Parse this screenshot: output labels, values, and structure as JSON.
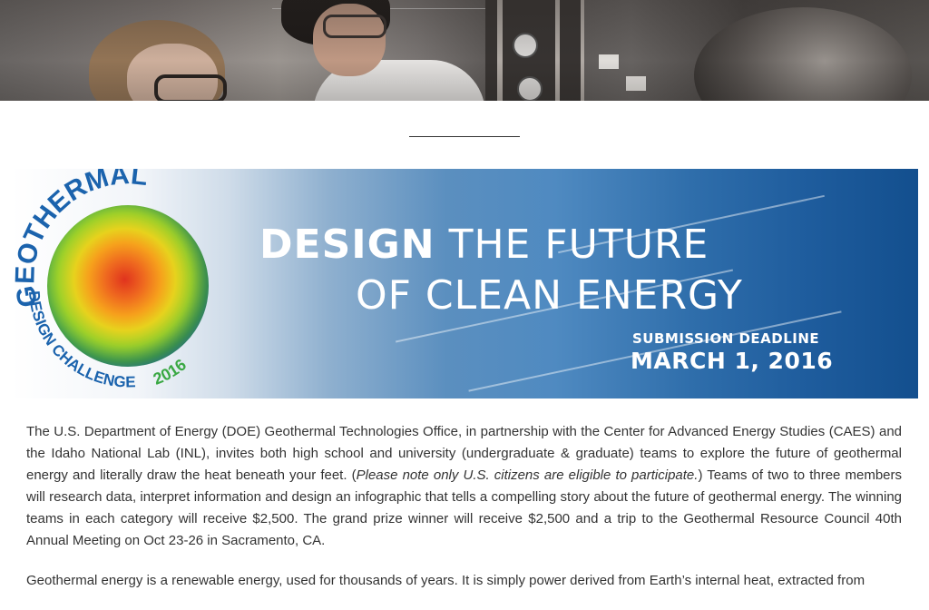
{
  "hero": {
    "image_description": "Two researchers wearing safety glasses working at lab equipment with gauges and pipes"
  },
  "banner": {
    "logo": {
      "arc_top": "GEOTHERMAL",
      "arc_bottom": "DESIGN CHALLENGE",
      "year": "2016"
    },
    "headline_bold": "DESIGN",
    "headline_rest": "THE FUTURE",
    "headline_line2": "OF CLEAN ENERGY",
    "deadline_label": "SUBMISSION DEADLINE",
    "deadline_date": "MARCH 1, 2016"
  },
  "content": {
    "p1_part1": "The U.S. Department of Energy (DOE) Geothermal Technologies Office, in partnership with the Center for Advanced Energy Studies (CAES) and the Idaho National Lab (INL), invites both high school and university (undergraduate & graduate) teams to explore the future of geothermal energy and literally draw the heat beneath your feet. (",
    "p1_italic": "Please note only U.S. citizens are eligible to participate.",
    "p1_part2": ") Teams of two to three members will research data, interpret information and design an infographic that tells a compelling story about the future of geothermal energy.  The winning teams in each category will receive $2,500.  The grand prize winner will receive $2,500 and a trip to the Geothermal Resource Council 40th Annual Meeting on Oct 23-26 in Sacramento, CA.",
    "p2": "Geothermal energy is a renewable energy, used for thousands of years.  It is simply power derived from Earth’s internal heat, extracted from"
  },
  "colors": {
    "banner_dark": "#134f8e",
    "text": "#333333",
    "logo_blue": "#1b63ad",
    "logo_green": "#3aa843"
  }
}
